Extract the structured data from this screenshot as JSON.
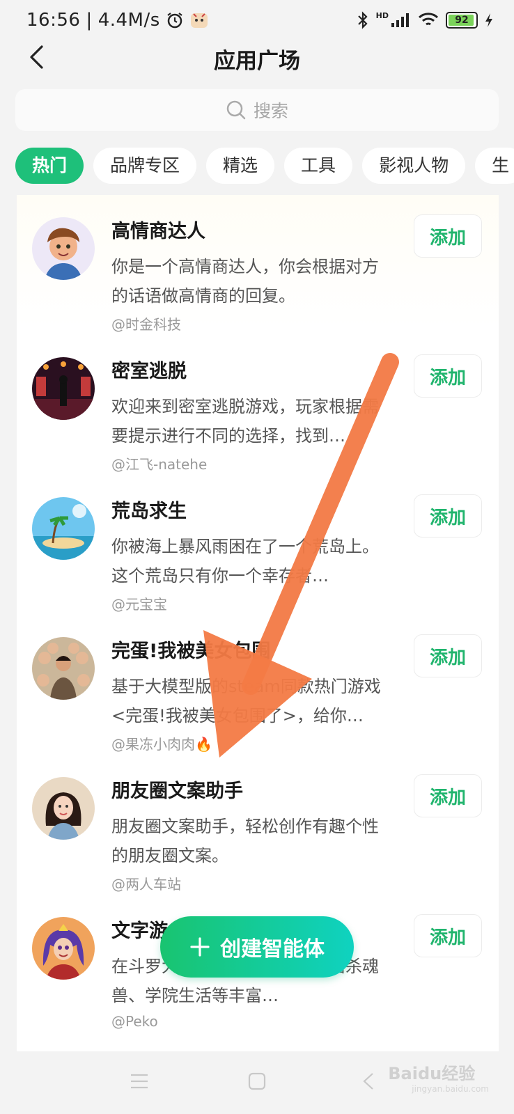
{
  "status_bar": {
    "time": "16:56",
    "speed": "4.4M/s",
    "signal": "HD",
    "battery": "92"
  },
  "header": {
    "title": "应用广场"
  },
  "search": {
    "placeholder": "搜索"
  },
  "tabs": [
    {
      "label": "热门",
      "active": true
    },
    {
      "label": "品牌专区"
    },
    {
      "label": "精选"
    },
    {
      "label": "工具"
    },
    {
      "label": "影视人物"
    },
    {
      "label": "生"
    }
  ],
  "items": [
    {
      "title": "高情商达人",
      "desc": "你是一个高情商达人，你会根据对方的话语做高情商的回复。",
      "author": "@时金科技",
      "add": "添加"
    },
    {
      "title": "密室逃脱",
      "desc": "欢迎来到密室逃脱游戏，玩家根据需要提示进行不同的选择，找到…",
      "author": "@江飞-natehe",
      "add": "添加"
    },
    {
      "title": "荒岛求生",
      "desc": "你被海上暴风雨困在了一个荒岛上。这个荒岛只有你一个幸存者…",
      "author": "@元宝宝",
      "add": "添加"
    },
    {
      "title": "完蛋!我被美女包围",
      "desc": "基于大模型版的steam同款热门游戏<完蛋!我被美女包围了>，给你…",
      "author": "@果冻小肉肉🔥",
      "add": "添加"
    },
    {
      "title": "朋友圈文案助手",
      "desc": "朋友圈文案助手，轻松创作有趣个性的朋友圈文案。",
      "author": "@两人车站",
      "add": "添加"
    },
    {
      "title": "文字游",
      "desc": "在斗罗大陆中体验武魂修炼、猎杀魂兽、学院生活等丰富…",
      "author": "@Peko",
      "add": "添加"
    }
  ],
  "create_button": {
    "label": "创建智能体"
  },
  "watermark": {
    "brand": "Baidu经验",
    "url": "jingyan.baidu.com"
  },
  "colors": {
    "accent": "#1ec07a",
    "arrow": "#f37a45"
  }
}
